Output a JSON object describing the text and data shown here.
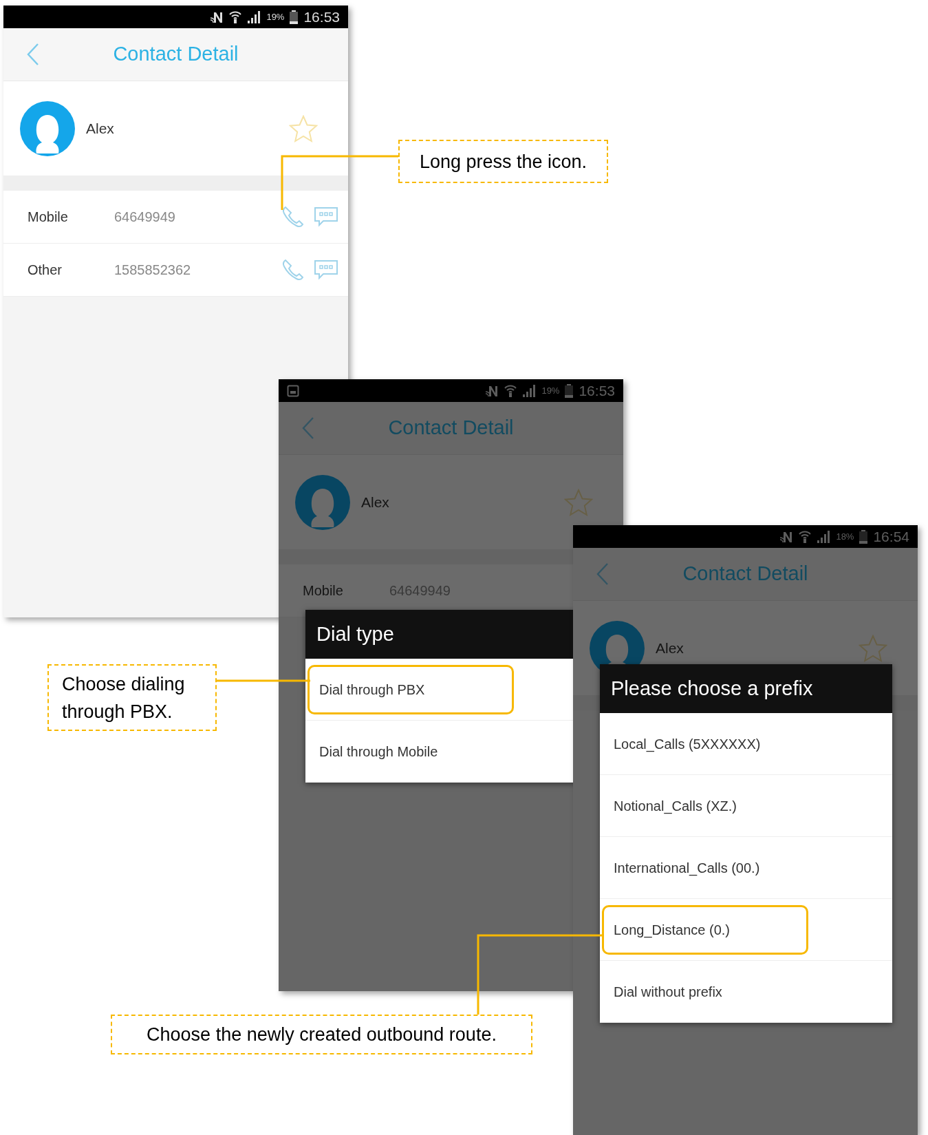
{
  "screens": [
    {
      "status_bar": {
        "notification_icon": false,
        "battery": "19%",
        "time": "16:53"
      },
      "title": "Contact Detail",
      "contact": {
        "name": "Alex"
      },
      "dimmed": false,
      "numbers": [
        {
          "label": "Mobile",
          "value": "64649949"
        },
        {
          "label": "Other",
          "value": "1585852362"
        }
      ]
    },
    {
      "status_bar": {
        "notification_icon": true,
        "battery": "19%",
        "time": "16:53"
      },
      "title": "Contact Detail",
      "contact": {
        "name": "Alex"
      },
      "dimmed": true,
      "numbers": [
        {
          "label": "Mobile",
          "value": "64649949"
        }
      ],
      "dialog": {
        "title": "Dial type",
        "options": [
          {
            "label": "Dial through PBX",
            "selected": true
          },
          {
            "label": "Dial through Mobile",
            "selected": false
          }
        ]
      }
    },
    {
      "status_bar": {
        "notification_icon": false,
        "battery": "18%",
        "time": "16:54"
      },
      "title": "Contact Detail",
      "contact": {
        "name": "Alex"
      },
      "dimmed": true,
      "dialog": {
        "title": "Please choose a prefix",
        "options": [
          {
            "label": "Local_Calls (5XXXXXX)",
            "selected": false
          },
          {
            "label": "Notional_Calls (XZ.)",
            "selected": false
          },
          {
            "label": "International_Calls (00.)",
            "selected": false
          },
          {
            "label": "Long_Distance (0.)",
            "selected": true
          },
          {
            "label": "Dial without prefix",
            "selected": false
          }
        ]
      }
    }
  ],
  "callouts": [
    {
      "text": "Long press the icon."
    },
    {
      "text": "Choose dialing through PBX."
    },
    {
      "text": "Choose the newly created outbound route."
    }
  ]
}
